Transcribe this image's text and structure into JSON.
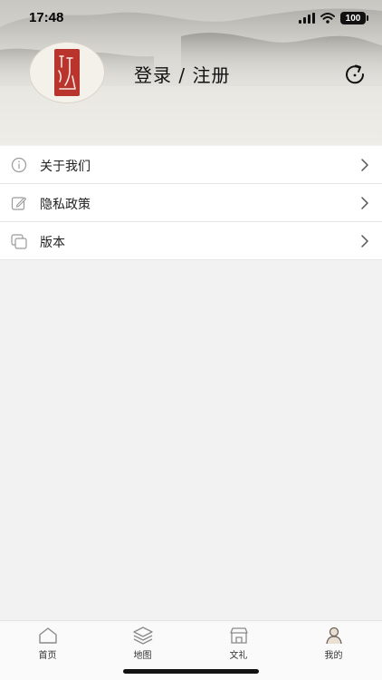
{
  "status_bar": {
    "time": "17:48",
    "battery": "100"
  },
  "header": {
    "login_label": "登录 / 注册"
  },
  "menu": {
    "items": [
      {
        "label": "关于我们",
        "icon": "info-icon"
      },
      {
        "label": "隐私政策",
        "icon": "edit-icon"
      },
      {
        "label": "版本",
        "icon": "version-icon"
      }
    ]
  },
  "tabbar": {
    "tabs": [
      {
        "label": "首页",
        "icon": "home-icon"
      },
      {
        "label": "地图",
        "icon": "layers-icon"
      },
      {
        "label": "文礼",
        "icon": "store-icon"
      },
      {
        "label": "我的",
        "icon": "profile-icon",
        "active": true
      }
    ]
  },
  "colors": {
    "seal_red": "#b8342c",
    "background": "#f2f2f2"
  }
}
